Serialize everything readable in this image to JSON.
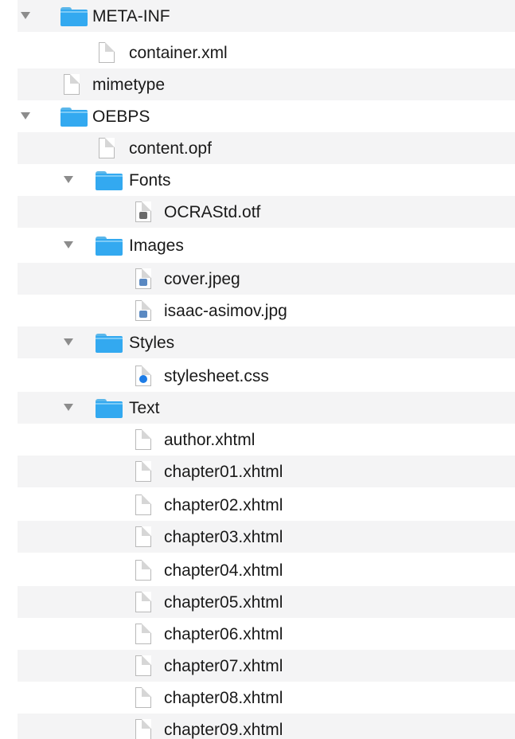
{
  "tree": [
    {
      "kind": "folder",
      "label": "META-INF",
      "expanded": true,
      "icon": "folder-icon"
    },
    {
      "kind": "file",
      "label": "container.xml",
      "icon": "document-icon"
    },
    {
      "kind": "file",
      "label": "mimetype",
      "icon": "document-icon"
    },
    {
      "kind": "folder",
      "label": "OEBPS",
      "expanded": true,
      "icon": "folder-icon"
    },
    {
      "kind": "file",
      "label": "content.opf",
      "icon": "document-icon"
    },
    {
      "kind": "folder",
      "label": "Fonts",
      "expanded": true,
      "icon": "folder-icon"
    },
    {
      "kind": "file",
      "label": "OCRAStd.otf",
      "icon": "font-file-icon"
    },
    {
      "kind": "folder",
      "label": "Images",
      "expanded": true,
      "icon": "folder-icon"
    },
    {
      "kind": "file",
      "label": "cover.jpeg",
      "icon": "image-file-icon"
    },
    {
      "kind": "file",
      "label": "isaac-asimov.jpg",
      "icon": "image-file-icon"
    },
    {
      "kind": "folder",
      "label": "Styles",
      "expanded": true,
      "icon": "folder-icon"
    },
    {
      "kind": "file",
      "label": "stylesheet.css",
      "icon": "css-file-icon"
    },
    {
      "kind": "folder",
      "label": "Text",
      "expanded": true,
      "icon": "folder-icon"
    },
    {
      "kind": "file",
      "label": "author.xhtml",
      "icon": "document-icon"
    },
    {
      "kind": "file",
      "label": "chapter01.xhtml",
      "icon": "document-icon"
    },
    {
      "kind": "file",
      "label": "chapter02.xhtml",
      "icon": "document-icon"
    },
    {
      "kind": "file",
      "label": "chapter03.xhtml",
      "icon": "document-icon"
    },
    {
      "kind": "file",
      "label": "chapter04.xhtml",
      "icon": "document-icon"
    },
    {
      "kind": "file",
      "label": "chapter05.xhtml",
      "icon": "document-icon"
    },
    {
      "kind": "file",
      "label": "chapter06.xhtml",
      "icon": "document-icon"
    },
    {
      "kind": "file",
      "label": "chapter07.xhtml",
      "icon": "document-icon"
    },
    {
      "kind": "file",
      "label": "chapter08.xhtml",
      "icon": "document-icon"
    },
    {
      "kind": "file",
      "label": "chapter09.xhtml",
      "icon": "document-icon"
    }
  ],
  "colors": {
    "folder": "#33a9f0",
    "stripe": "#f4f4f5",
    "disclosure": "#8c8c8c"
  }
}
